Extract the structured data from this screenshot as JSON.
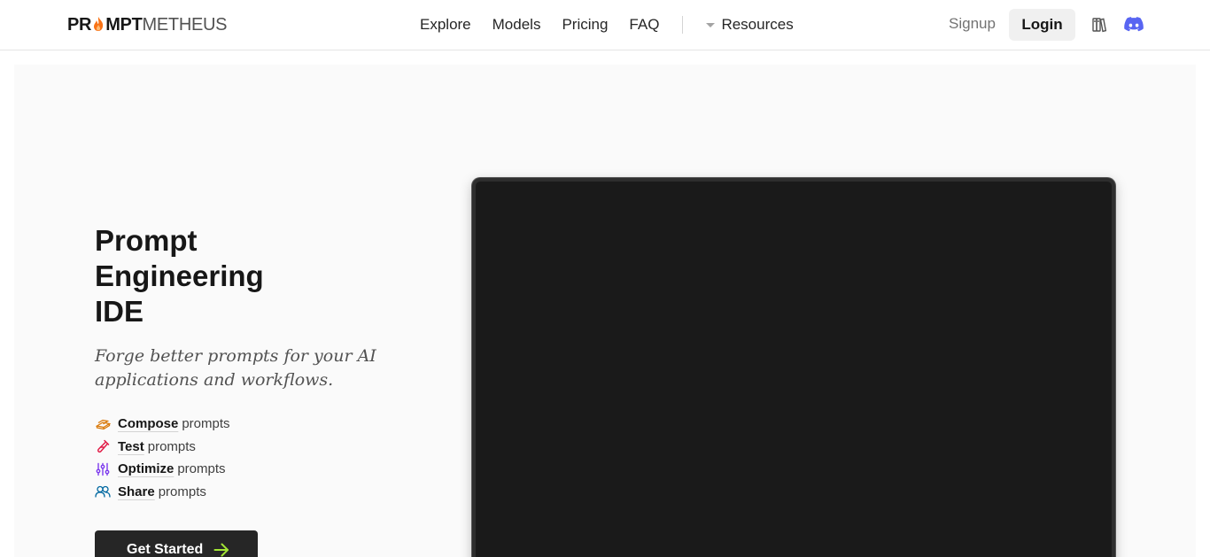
{
  "logo": {
    "part1": "PR",
    "part2": "MPT",
    "part3": "METHEUS"
  },
  "nav": {
    "items": [
      "Explore",
      "Models",
      "Pricing",
      "FAQ"
    ],
    "resources_label": "Resources"
  },
  "auth": {
    "signup_label": "Signup",
    "login_label": "Login"
  },
  "icons": {
    "docs": "books-icon",
    "discord": "discord-icon",
    "flame": "flame-icon"
  },
  "hero": {
    "title": "Prompt\nEngineering\nIDE",
    "subtitle": "Forge better prompts for your AI applications and workflows.",
    "features": [
      {
        "verb": "Compose",
        "rest": "prompts",
        "icon": "bricks-icon",
        "color": "#d97706"
      },
      {
        "verb": "Test",
        "rest": "prompts",
        "icon": "test-tube-icon",
        "color": "#e11d48"
      },
      {
        "verb": "Optimize",
        "rest": "prompts",
        "icon": "sliders-icon",
        "color": "#7c3aed"
      },
      {
        "verb": "Share",
        "rest": "prompts",
        "icon": "users-icon",
        "color": "#0369a1"
      }
    ],
    "cta_label": "Get Started"
  },
  "colors": {
    "accent_green": "#a3e635",
    "discord": "#5865f2",
    "flame": "#f97316"
  }
}
